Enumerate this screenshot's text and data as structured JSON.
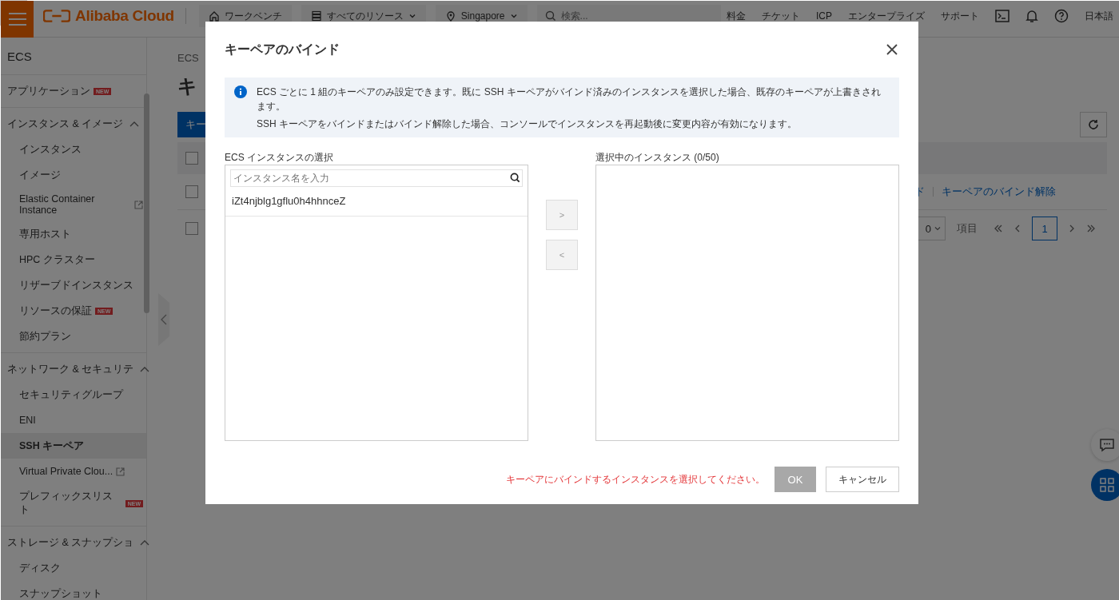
{
  "topbar": {
    "logo": "Alibaba Cloud",
    "nav": [
      {
        "label": "ワークベンチ",
        "dropdown": false
      },
      {
        "label": "すべてのリソース",
        "dropdown": true
      },
      {
        "label": "Singapore",
        "dropdown": true
      }
    ],
    "search": {
      "placeholder": "検索..."
    },
    "links": [
      "料金",
      "チケット",
      "ICP",
      "エンタープライズ",
      "サポート"
    ],
    "language": "日本語"
  },
  "sidebar": {
    "title": "ECS",
    "sections": [
      {
        "label": "アプリケーション",
        "badge": "NEW"
      },
      {
        "label": "インスタンス & イメージ",
        "expanded": true,
        "children": [
          {
            "label": "インスタンス",
            "selected": false,
            "external": false
          },
          {
            "label": "イメージ",
            "selected": false,
            "external": false
          },
          {
            "label": "Elastic Container Instance",
            "selected": false,
            "external": true
          },
          {
            "label": "専用ホスト",
            "selected": false,
            "external": false
          },
          {
            "label": "HPC クラスター",
            "selected": false,
            "external": false
          },
          {
            "label": "リザーブドインスタンス",
            "selected": false,
            "external": false
          },
          {
            "label": "リソースの保証",
            "selected": false,
            "external": false,
            "badge": "NEW"
          },
          {
            "label": "節約プラン",
            "selected": false,
            "external": false
          }
        ]
      },
      {
        "label": "ネットワーク & セキュリテ",
        "expanded": true,
        "children": [
          {
            "label": "セキュリティグループ",
            "selected": false,
            "external": false
          },
          {
            "label": "ENI",
            "selected": false,
            "external": false
          },
          {
            "label": "SSH キーペア",
            "selected": true,
            "external": false
          },
          {
            "label": "Virtual Private Clou...",
            "selected": false,
            "external": true
          },
          {
            "label": "プレフィックスリスト",
            "selected": false,
            "external": false,
            "badge": "NEW"
          }
        ]
      },
      {
        "label": "ストレージ & スナップショ",
        "expanded": true,
        "children": [
          {
            "label": "ディスク",
            "selected": false,
            "external": false
          },
          {
            "label": "スナップショット",
            "selected": false,
            "external": false
          }
        ]
      }
    ]
  },
  "main": {
    "breadcrumb": "ECS",
    "title": "キ",
    "create_button": "キー",
    "table": {
      "header_checked": false,
      "rows": [
        {
          "checked": false,
          "actions": [
            "ド",
            "キーペアのバインド解除"
          ]
        }
      ]
    },
    "pagination": {
      "checked": false,
      "page_size": "0",
      "unit": "項目",
      "pages": [
        {
          "label": "1",
          "selected": true
        }
      ]
    }
  },
  "dialog": {
    "title": "キーペアのバインド",
    "info": [
      "ECS ごとに 1 組のキーペアのみ設定できます。既に SSH キーペアがバインド済みのインスタンスを選択した場合、既存のキーペアが上書きされます。",
      "SSH キーペアをバインドまたはバインド解除した場合、コンソールでインスタンスを再起動後に変更内容が有効になります。"
    ],
    "source": {
      "title": "ECS インスタンスの選択",
      "search": {
        "placeholder": "インスタンス名を入力"
      },
      "items": [
        "iZt4njblg1gflu0h4hhnceZ"
      ]
    },
    "transfer_buttons": [
      {
        "label": ">",
        "disabled": true
      },
      {
        "label": "<",
        "disabled": true
      }
    ],
    "target": {
      "title": "選択中のインスタンス (0/50)"
    },
    "error": "キーペアにバインドするインスタンスを選択してください。",
    "ok": {
      "label": "OK",
      "disabled": true
    },
    "cancel": "キャンセル"
  }
}
